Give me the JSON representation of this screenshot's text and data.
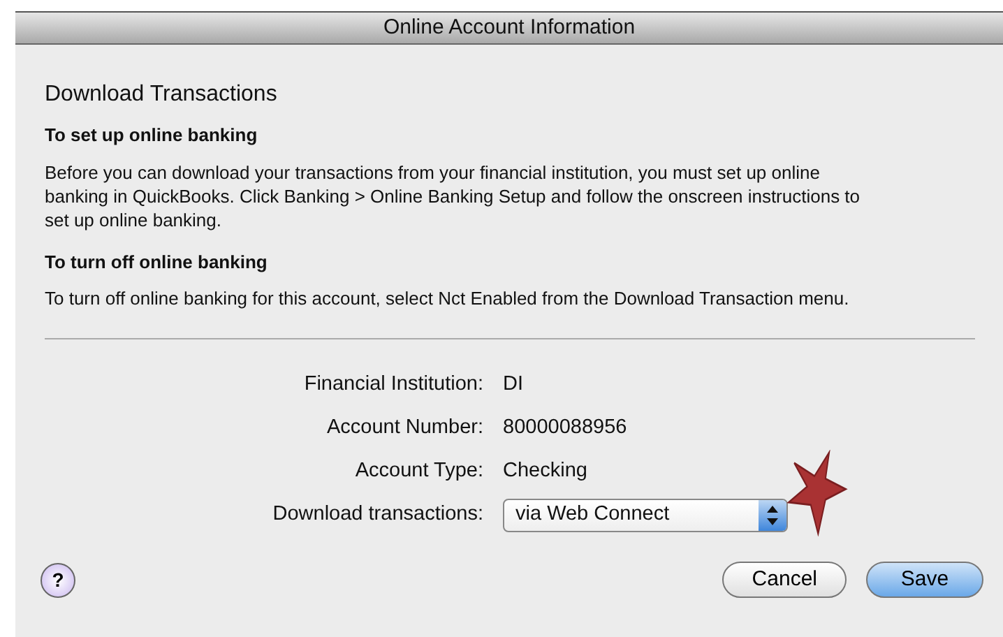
{
  "window": {
    "title": "Online Account Information"
  },
  "heading": "Download Transactions",
  "sections": [
    {
      "heading": "To set up online banking",
      "text": "Before you can download your transactions from your financial  institution, you must set up online banking in QuickBooks. Click Banking > Online Banking Setup and follow the onscreen instructions to set up online banking."
    },
    {
      "heading": "To turn off online banking",
      "text": "To turn off online banking for this account, select Nct Enabled from the Download Transaction menu."
    }
  ],
  "fields": [
    {
      "kind": "text",
      "label": "Financial Institution:",
      "value": "DI"
    },
    {
      "kind": "text",
      "label": "Account Number:",
      "value": "80000088956"
    },
    {
      "kind": "text",
      "label": "Account Type:",
      "value": "Checking"
    },
    {
      "kind": "select",
      "label": "Download transactions:",
      "value": "via Web Connect"
    }
  ],
  "help": "?",
  "buttons": [
    {
      "label": "Cancel",
      "default": false
    },
    {
      "label": "Save",
      "default": true
    }
  ]
}
